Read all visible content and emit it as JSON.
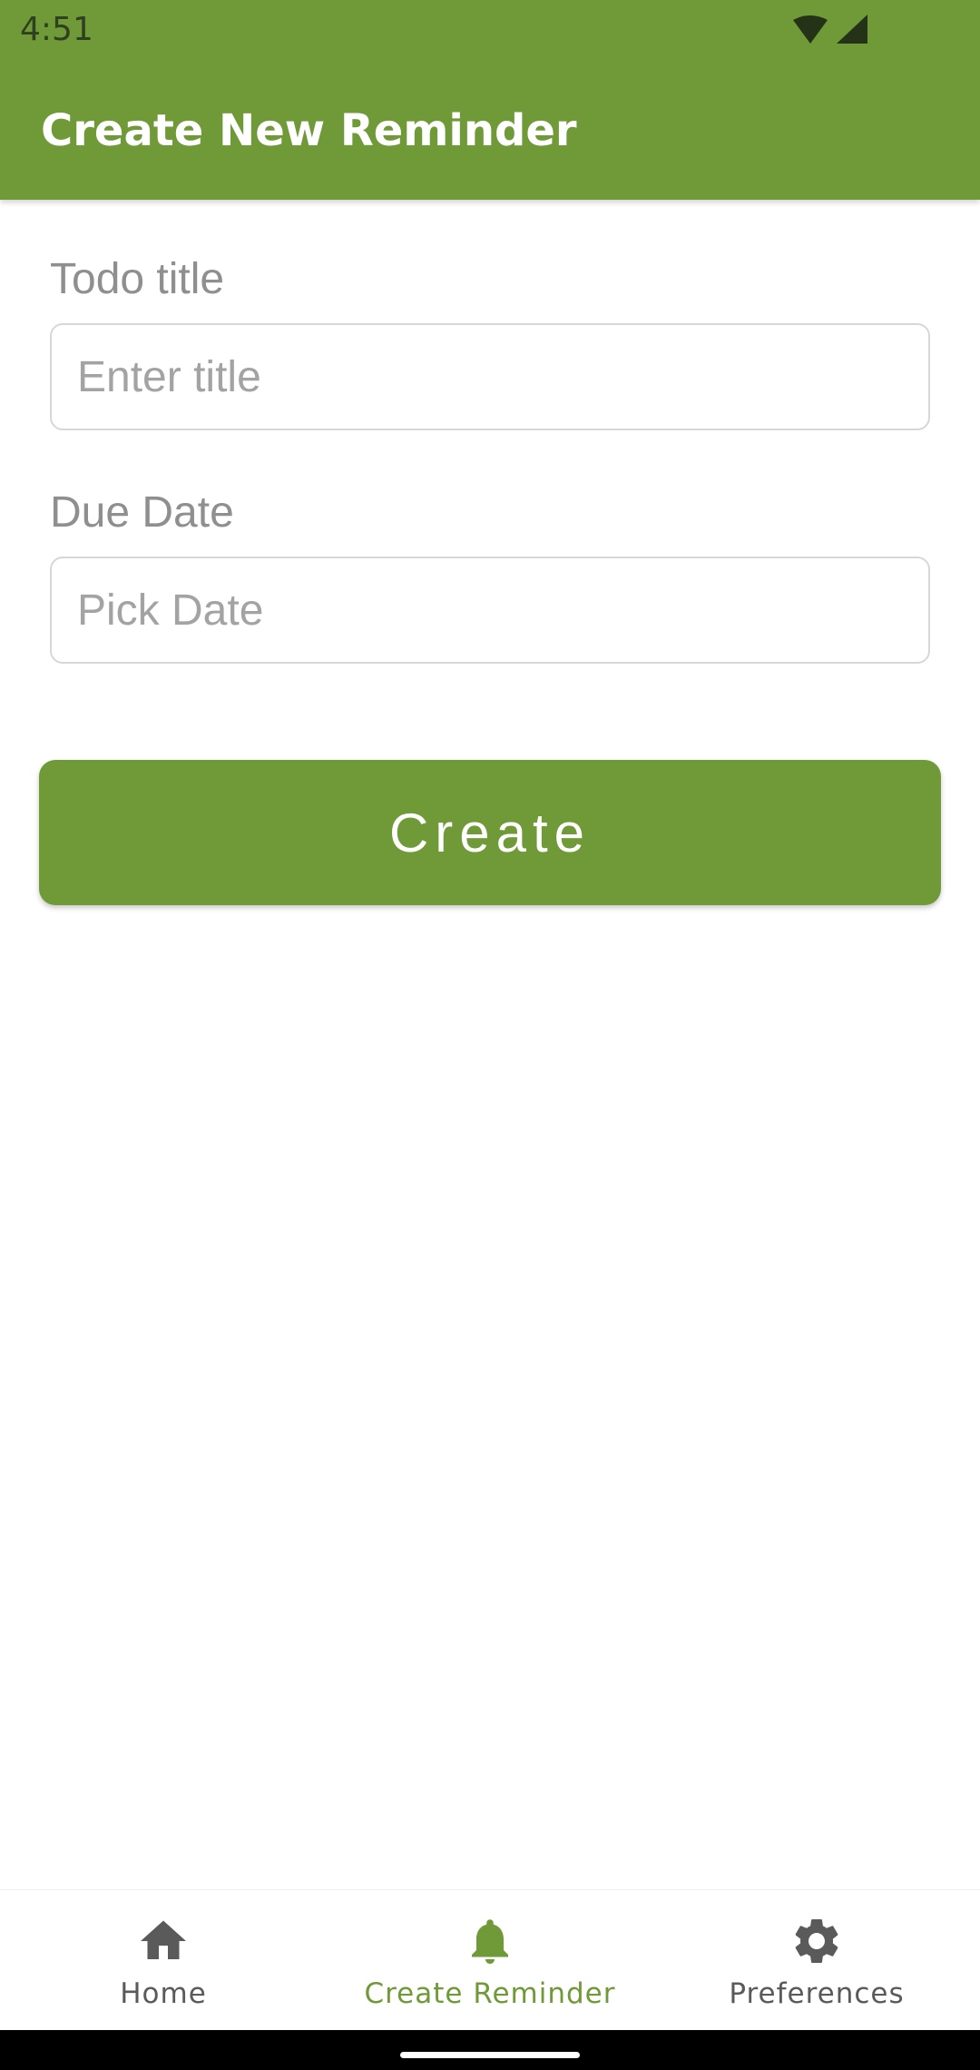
{
  "status_bar": {
    "time": "4:51"
  },
  "app_bar": {
    "title": "Create New Reminder"
  },
  "form": {
    "title_field": {
      "label": "Todo title",
      "value": "",
      "placeholder": "Enter title"
    },
    "date_field": {
      "label": "Due Date",
      "value": "",
      "placeholder": "Pick Date"
    },
    "submit_label": "Create"
  },
  "bottom_nav": {
    "items": [
      {
        "label": "Home",
        "icon": "home-icon",
        "active": false
      },
      {
        "label": "Create Reminder",
        "icon": "bell-icon",
        "active": true
      },
      {
        "label": "Preferences",
        "icon": "gear-icon",
        "active": false
      }
    ]
  },
  "colors": {
    "primary": "#6f9a37",
    "inactive_nav": "#5a5a5a",
    "label_gray": "#8f8f8f"
  }
}
